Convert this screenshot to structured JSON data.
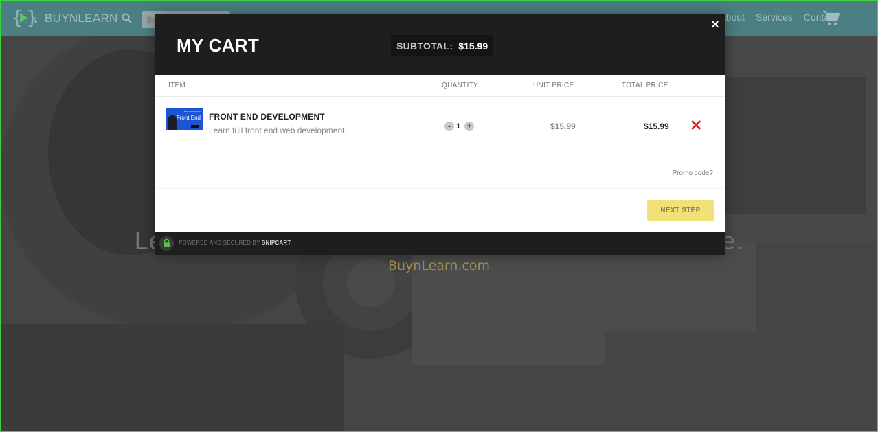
{
  "site": {
    "brand": "BUYNLEARN",
    "search_placeholder": "Search",
    "nav_links": [
      "About",
      "Services",
      "Contact"
    ],
    "hero_title": "Learn to code from anywhere, anytime, with anyone.",
    "hero_subtitle": "BuynLearn.com"
  },
  "cart": {
    "title": "MY CART",
    "subtotal_label": "SUBTOTAL:",
    "subtotal_value": "$15.99",
    "close": "×",
    "columns": {
      "item": "ITEM",
      "quantity": "QUANTITY",
      "unit_price": "UNIT PRICE",
      "total_price": "TOTAL PRICE"
    },
    "items": [
      {
        "name": "FRONT END DEVELOPMENT",
        "description": "Learn full front end web development.",
        "thumb_label": "Front End",
        "quantity": "1",
        "minus": "-",
        "plus": "+",
        "unit_price": "$15.99",
        "total_price": "$15.99",
        "remove": "✕"
      }
    ],
    "promo": "Promo code?",
    "next_button": "NEXT STEP",
    "footer_prefix": "POWERED AND SECURED BY",
    "footer_brand": "SNIPCART"
  },
  "colors": {
    "navbar": "#4b7f83",
    "modal_header": "#1e1e1e",
    "next_button": "#f2e177",
    "remove": "#e31b1b",
    "hero_subtitle": "#a38f4a"
  }
}
